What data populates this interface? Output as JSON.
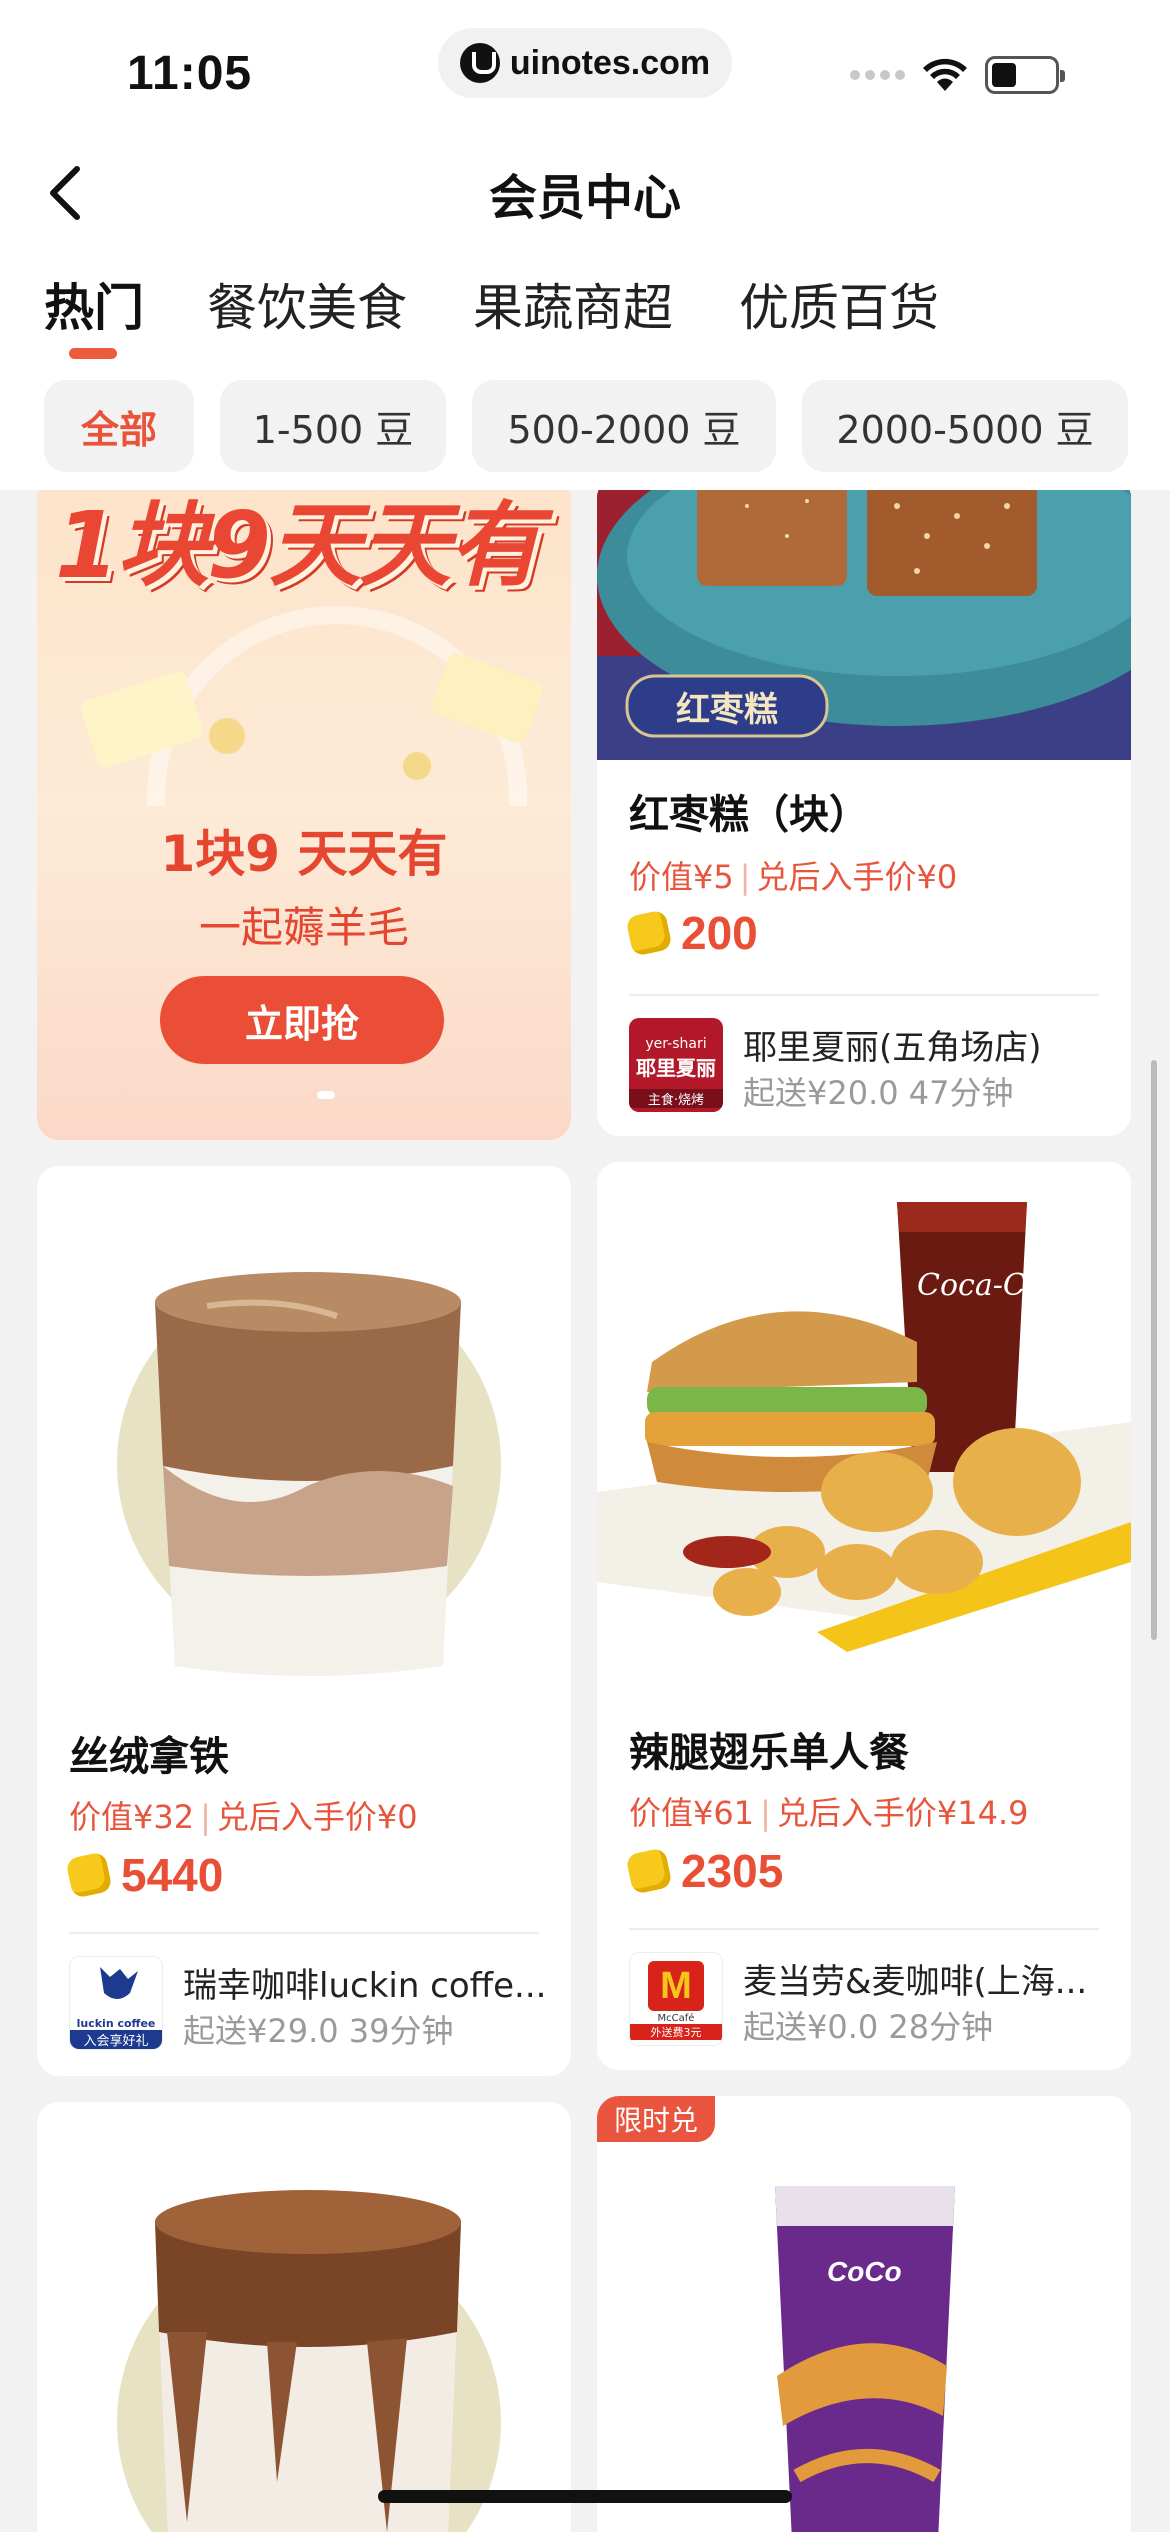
{
  "status_bar": {
    "time": "11:05",
    "url": "uinotes.com"
  },
  "header": {
    "title": "会员中心"
  },
  "tabs": [
    {
      "label": "热门"
    },
    {
      "label": "餐饮美食"
    },
    {
      "label": "果蔬商超"
    },
    {
      "label": "优质百货"
    }
  ],
  "filters": [
    {
      "label": "全部"
    },
    {
      "label": "1-500 豆"
    },
    {
      "label": "500-2000 豆"
    },
    {
      "label": "2000-5000 豆"
    }
  ],
  "promo": {
    "banner": "1块9天天有",
    "title": "1块9 天天有",
    "subtitle": "一起薅羊毛",
    "button": "立即抢"
  },
  "products": [
    {
      "image_label": "红枣糕",
      "title": "红枣糕（块）",
      "value": "价值¥5",
      "after_price": "兑后入手价¥0",
      "coins": "200",
      "store_logo_text": "yer-shari",
      "store_logo_sub": "耶里夏丽",
      "store_logo_tag": "主食·烧烤",
      "store": "耶里夏丽(五角场店)",
      "delivery": "起送¥20.0 47分钟"
    },
    {
      "title": "丝绒拿铁",
      "value": "价值¥32",
      "after_price": "兑后入手价¥0",
      "coins": "5440",
      "store_logo_text": "luckin coffee",
      "store_logo_tag": "入会享好礼",
      "store": "瑞幸咖啡luckin coffe...",
      "delivery": "起送¥29.0 39分钟"
    },
    {
      "image_label": "Coca-Cola",
      "title": "辣腿翅乐单人餐",
      "value": "价值¥61",
      "after_price": "兑后入手价¥14.9",
      "coins": "2305",
      "store_logo_text": "McCafé",
      "store_logo_tag": "外送费3元",
      "store": "麦当劳&麦咖啡(上海...",
      "delivery": "起送¥0.0 28分钟"
    },
    {
      "badge": "限时兑",
      "image_label": "CoCo"
    }
  ],
  "colors": {
    "accent": "#e8533a",
    "coin": "#f6c91c",
    "background": "#f2f2f2"
  }
}
